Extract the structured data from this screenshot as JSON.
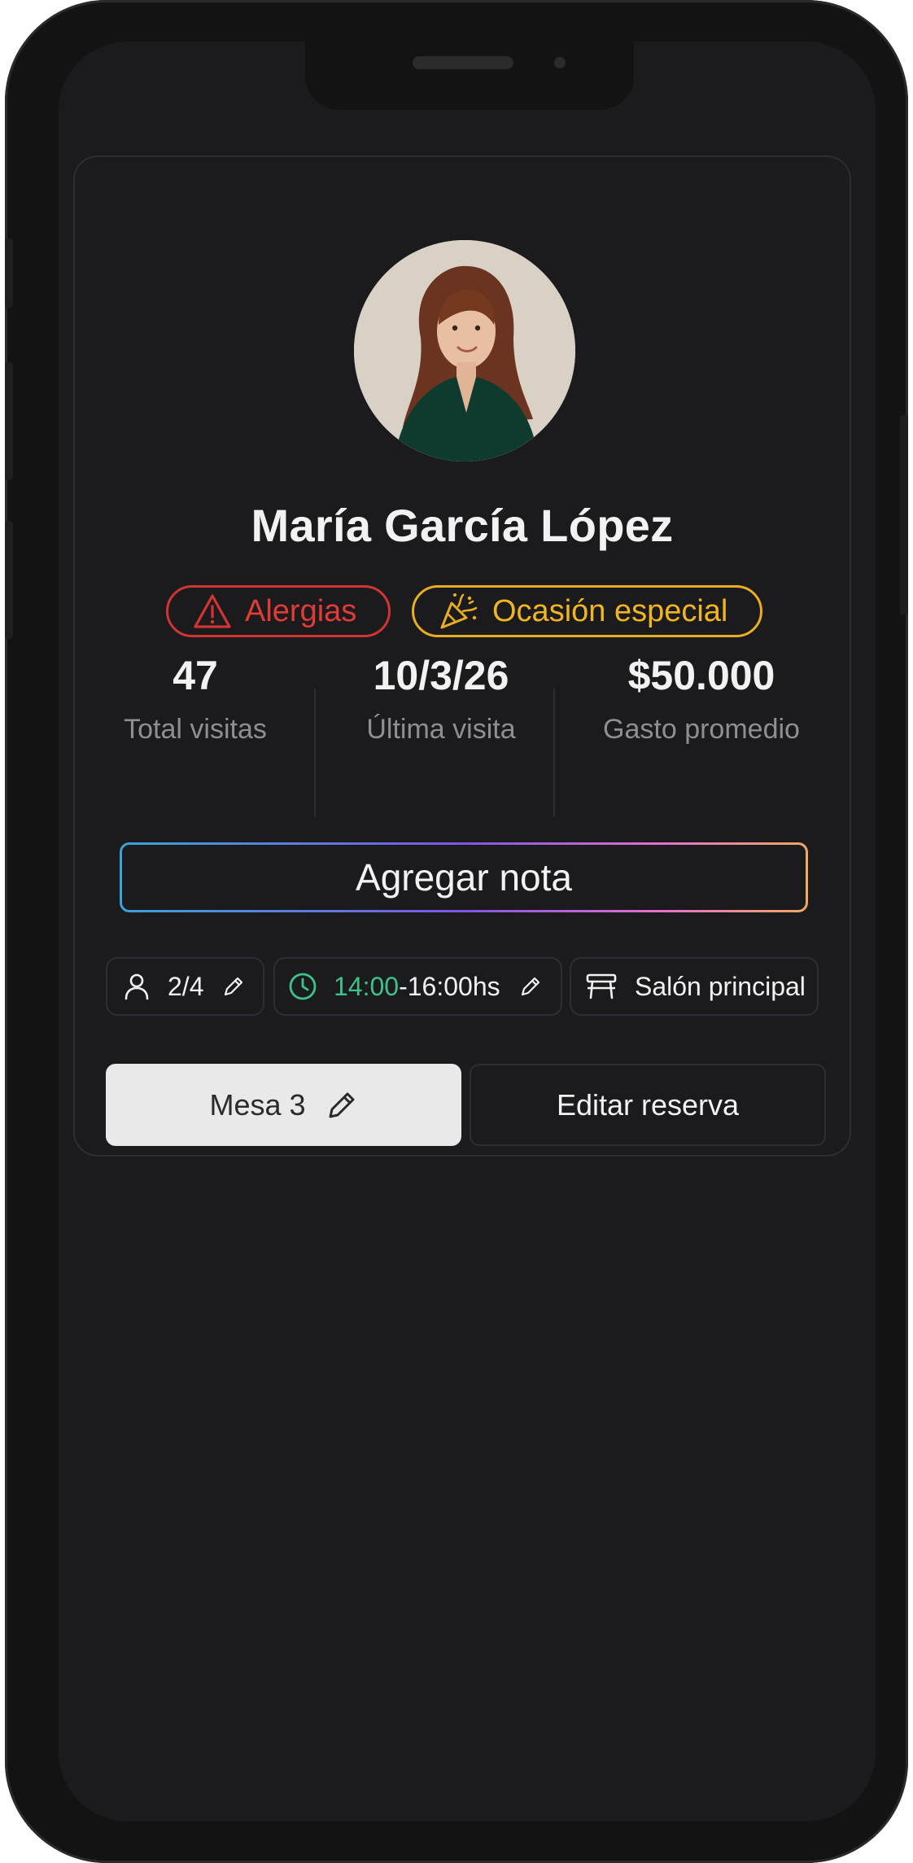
{
  "customer": {
    "name": "María García López",
    "avatar_alt": "Foto de perfil"
  },
  "badges": {
    "allergy": {
      "label": "Alergias",
      "icon": "warning-triangle-icon",
      "color": "#e03b36"
    },
    "occasion": {
      "label": "Ocasión especial",
      "icon": "party-popper-icon",
      "color": "#f0b520"
    }
  },
  "stats": [
    {
      "value": "47",
      "label": "Total visitas"
    },
    {
      "value": "10/3/26",
      "label": "Última visita"
    },
    {
      "value": "$50.000",
      "label": "Gasto promedio"
    }
  ],
  "actions": {
    "add_note": "Agregar nota",
    "table": "Mesa 3",
    "edit_reservation": "Editar reserva"
  },
  "reservation": {
    "guests": "2/4",
    "time_start": "14:00",
    "time_end": "-16:00hs",
    "area": "Salón principal"
  },
  "colors": {
    "accent_green": "#3ec28c",
    "background": "#1b1b1d"
  }
}
